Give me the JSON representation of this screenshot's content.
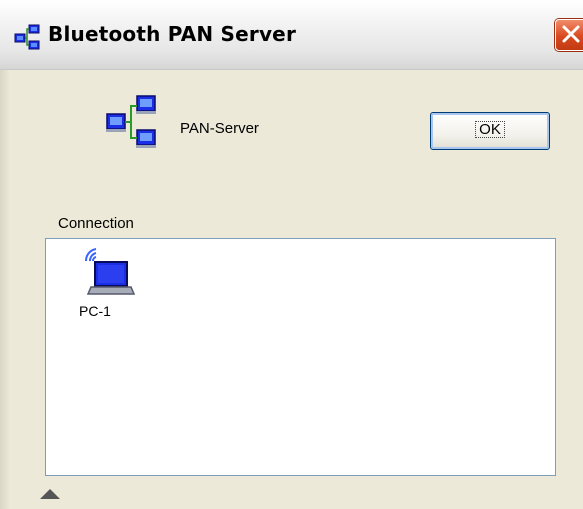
{
  "window": {
    "title": "Bluetooth PAN Server"
  },
  "server": {
    "label": "PAN-Server"
  },
  "buttons": {
    "ok_label": "OK"
  },
  "connection": {
    "label": "Connection",
    "items": [
      {
        "label": "PC-1"
      }
    ]
  },
  "icons": {
    "title": "network-icon",
    "server": "network-server-icon",
    "device": "bluetooth-laptop-icon",
    "close": "close-icon",
    "expand": "triangle-up-icon"
  },
  "colors": {
    "close_button": "#d84a20",
    "icon_blue": "#1a2ee6",
    "list_border": "#7f9db9",
    "dialog_bg": "#ece9d8"
  }
}
